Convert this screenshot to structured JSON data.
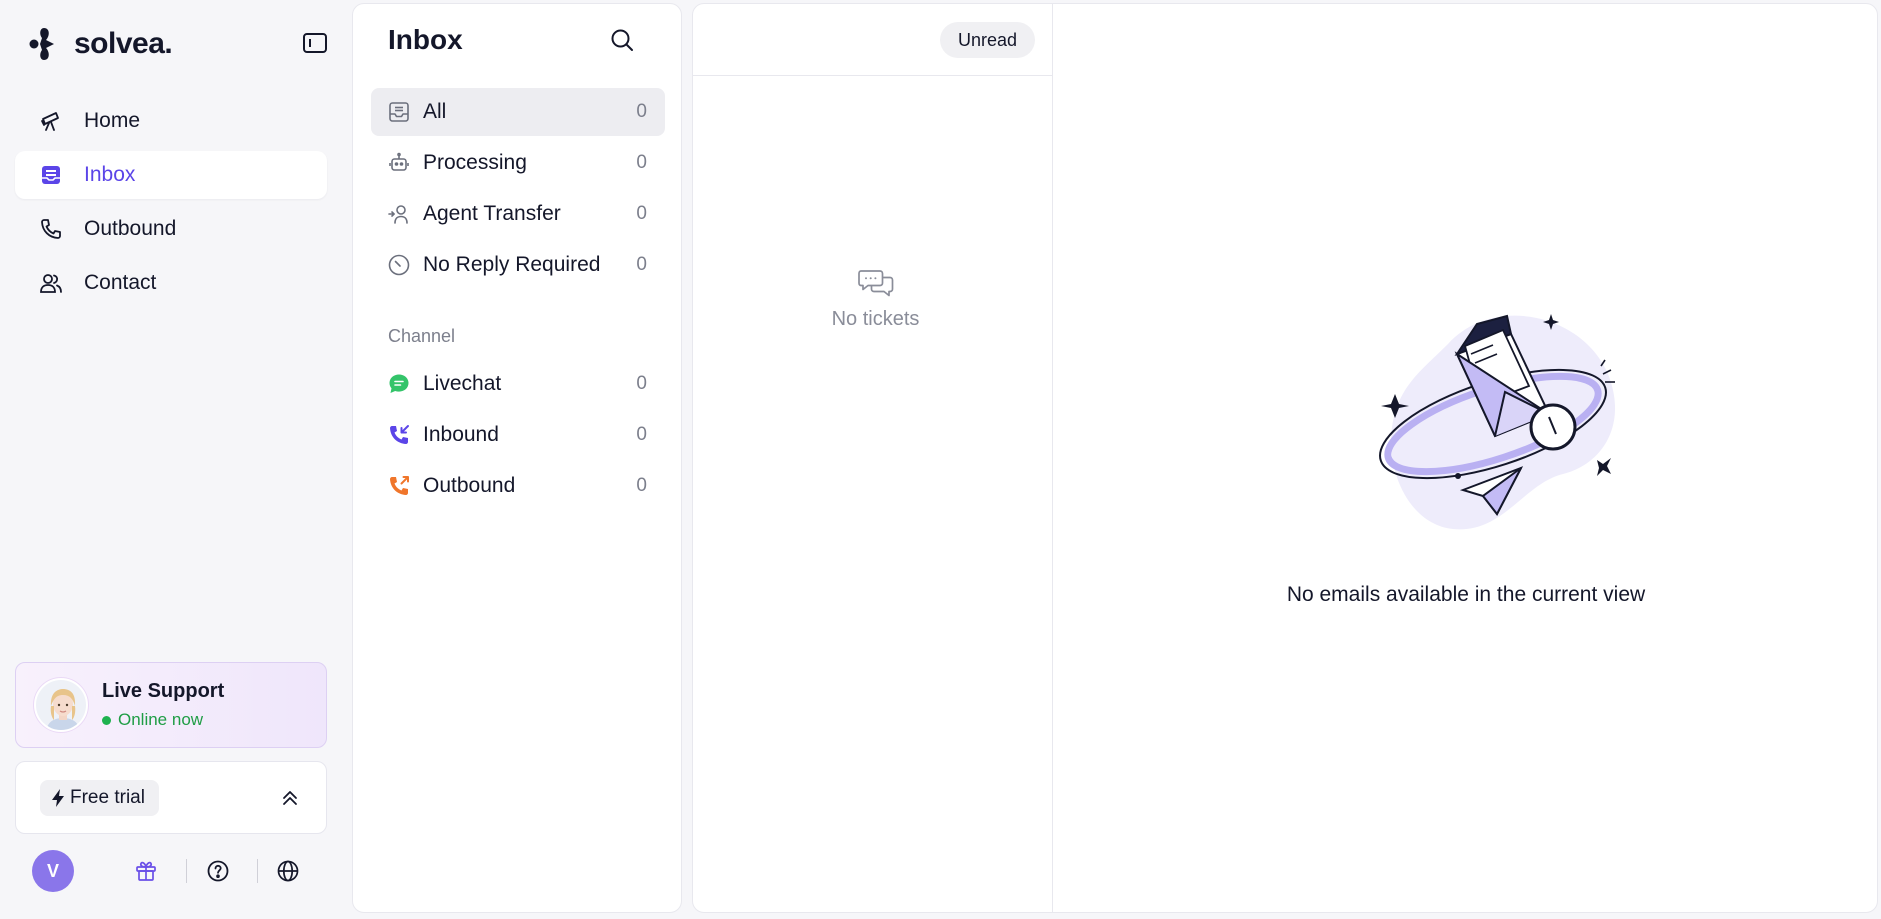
{
  "brand": {
    "name": "solvea."
  },
  "sidebar": {
    "nav": [
      {
        "label": "Home",
        "icon": "telescope-icon",
        "active": false
      },
      {
        "label": "Inbox",
        "icon": "inbox-icon",
        "active": true
      },
      {
        "label": "Outbound",
        "icon": "phone-icon",
        "active": false
      },
      {
        "label": "Contact",
        "icon": "users-icon",
        "active": false
      }
    ],
    "support": {
      "title": "Live Support",
      "status": "Online now"
    },
    "trial": {
      "label": "Free trial"
    },
    "user": {
      "initial": "V"
    }
  },
  "inbox": {
    "title": "Inbox",
    "folders": [
      {
        "label": "All",
        "count": "0",
        "icon": "inbox-tray-icon"
      },
      {
        "label": "Processing",
        "count": "0",
        "icon": "robot-icon"
      },
      {
        "label": "Agent Transfer",
        "count": "0",
        "icon": "agent-transfer-icon"
      },
      {
        "label": "No Reply Required",
        "count": "0",
        "icon": "no-reply-icon"
      }
    ],
    "channel_label": "Channel",
    "channels": [
      {
        "label": "Livechat",
        "count": "0",
        "icon": "livechat-icon",
        "color": "#34c46a"
      },
      {
        "label": "Inbound",
        "count": "0",
        "icon": "inbound-call-icon",
        "color": "#5b45e8"
      },
      {
        "label": "Outbound",
        "count": "0",
        "icon": "outbound-call-icon",
        "color": "#f0762b"
      }
    ]
  },
  "tickets": {
    "filter_label": "Unread",
    "empty_text": "No tickets"
  },
  "detail": {
    "empty_text": "No emails available in the current view"
  },
  "colors": {
    "accent": "#5b45e8",
    "online": "#1fb24f",
    "avatar": "#8a76ea"
  }
}
